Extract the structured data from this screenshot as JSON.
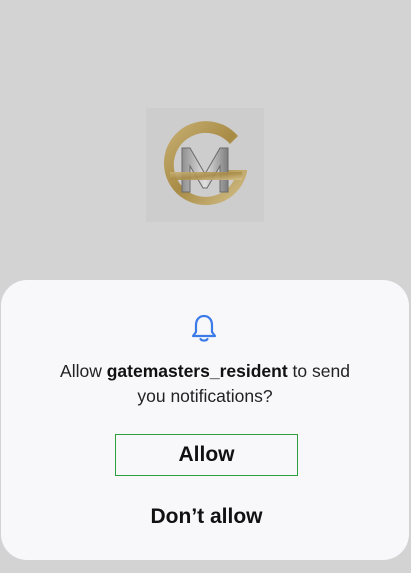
{
  "app": {
    "logo": "gatemasters-logo"
  },
  "dialog": {
    "icon": "bell-icon",
    "message": {
      "prefix": "Allow ",
      "app_name": "gatemasters_resident",
      "suffix_line1": " to send",
      "line2": "you notifications?"
    },
    "allow_label": "Allow",
    "deny_label": "Don’t allow"
  },
  "colors": {
    "backdrop": "#d3d3d3",
    "sheet": "#f8f8fb",
    "bell": "#3b7be8",
    "allow_border": "#2e9e3e",
    "logo_gold": "#b8a05a"
  }
}
